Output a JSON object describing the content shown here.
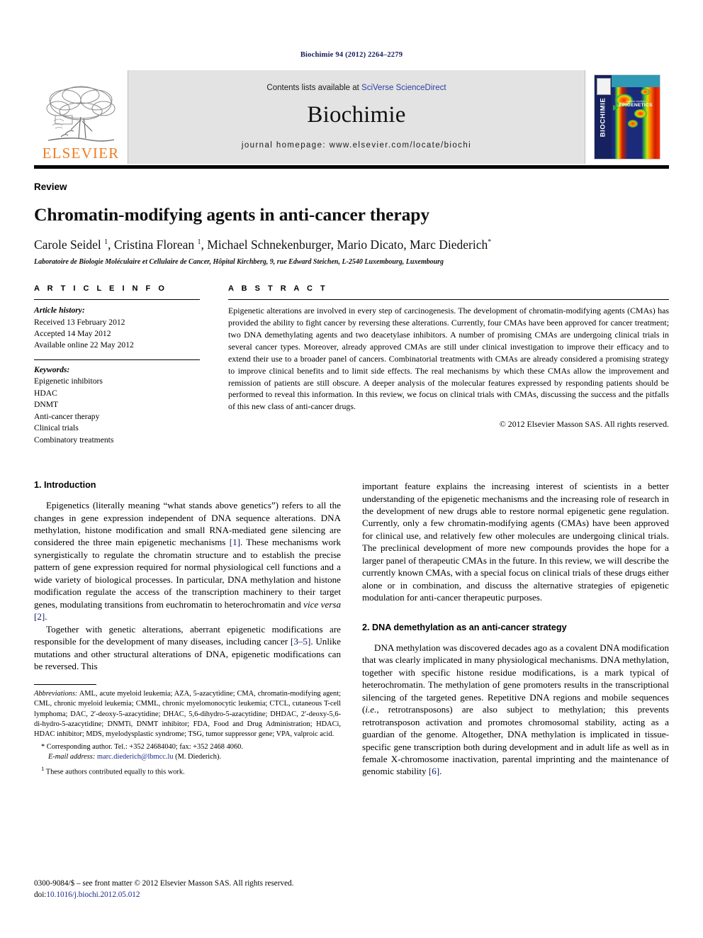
{
  "running_head": "Biochimie 94 (2012) 2264–2279",
  "masthead": {
    "publisher_logo_text": "ELSEVIER",
    "contents_prefix": "Contents lists available at ",
    "contents_link": "SciVerse ScienceDirect",
    "journal_name": "Biochimie",
    "homepage_line": "journal homepage: www.elsevier.com/locate/biochi",
    "cover": {
      "spine_title": "BIOCHIMIE",
      "caption_small": "Special section",
      "caption_big": "EPIGENETICS"
    }
  },
  "article": {
    "doctype": "Review",
    "title": "Chromatin-modifying agents in anti-cancer therapy",
    "authors_html": "Carole Seidel <sup>1</sup>, Cristina Florean <sup>1</sup>, Michael Schnekenburger, Mario Dicato, Marc Diederich<sup class=\"star\">*</sup>",
    "affiliation": "Laboratoire de Biologie Moléculaire et Cellulaire de Cancer, Hôpital Kirchberg, 9, rue Edward Steichen, L-2540 Luxembourg, Luxembourg"
  },
  "article_info": {
    "heading": "A R T I C L E  I N F O",
    "history_label": "Article history:",
    "history": [
      "Received 13 February 2012",
      "Accepted 14 May 2012",
      "Available online 22 May 2012"
    ],
    "keywords_label": "Keywords:",
    "keywords": [
      "Epigenetic inhibitors",
      "HDAC",
      "DNMT",
      "Anti-cancer therapy",
      "Clinical trials",
      "Combinatory treatments"
    ]
  },
  "abstract": {
    "heading": "A B S T R A C T",
    "text": "Epigenetic alterations are involved in every step of carcinogenesis. The development of chromatin-modifying agents (CMAs) has provided the ability to fight cancer by reversing these alterations. Currently, four CMAs have been approved for cancer treatment; two DNA demethylating agents and two deacetylase inhibitors. A number of promising CMAs are undergoing clinical trials in several cancer types. Moreover, already approved CMAs are still under clinical investigation to improve their efficacy and to extend their use to a broader panel of cancers. Combinatorial treatments with CMAs are already considered a promising strategy to improve clinical benefits and to limit side effects. The real mechanisms by which these CMAs allow the improvement and remission of patients are still obscure. A deeper analysis of the molecular features expressed by responding patients should be performed to reveal this information. In this review, we focus on clinical trials with CMAs, discussing the success and the pitfalls of this new class of anti-cancer drugs.",
    "copyright": "© 2012 Elsevier Masson SAS. All rights reserved."
  },
  "sections": {
    "intro_heading": "1.  Introduction",
    "intro_p1_a": "Epigenetics (literally meaning “what stands above genetics”) refers to all the changes in gene expression independent of DNA sequence alterations. DNA methylation, histone modification and small RNA-mediated gene silencing are considered the three main epigenetic mechanisms ",
    "intro_p1_ref1": "[1]",
    "intro_p1_b": ". These mechanisms work synergistically to regulate the chromatin structure and to establish the precise pattern of gene expression required for normal physiological cell functions and a wide variety of biological processes. In particular, DNA methylation and histone modification regulate the access of the transcription machinery to their target genes, modulating transitions from euchromatin to heterochromatin and ",
    "intro_p1_italic": "vice versa",
    "intro_p1_ref2": " [2]",
    "intro_p1_c": ".",
    "intro_p2_a": "Together with genetic alterations, aberrant epigenetic modifications are responsible for the development of many diseases, including cancer ",
    "intro_p2_ref": "[3–5]",
    "intro_p2_b": ". Unlike mutations and other structural alterations of DNA, epigenetic modifications can be reversed. This ",
    "intro_p2_cont": "important feature explains the increasing interest of scientists in a better understanding of the epigenetic mechanisms and the increasing role of research in the development of new drugs able to restore normal epigenetic gene regulation. Currently, only a few chromatin-modifying agents (CMAs) have been approved for clinical use, and relatively few other molecules are undergoing clinical trials. The preclinical development of more new compounds provides the hope for a larger panel of therapeutic CMAs in the future. In this review, we will describe the currently known CMAs, with a special focus on clinical trials of these drugs either alone or in combination, and discuss the alternative strategies of epigenetic modulation for anti-cancer therapeutic purposes.",
    "demeth_heading": "2.  DNA demethylation as an anti-cancer strategy",
    "demeth_p1_a": "DNA methylation was discovered decades ago as a covalent DNA modification that was clearly implicated in many physiological mechanisms. DNA methylation, together with specific histone residue modifications, is a mark typical of heterochromatin. The methylation of gene promoters results in the transcriptional silencing of the targeted genes. Repetitive DNA regions and mobile sequences (",
    "demeth_p1_italic": "i.e.",
    "demeth_p1_b": ", retrotransposons) are also subject to methylation; this prevents retrotransposon activation and promotes chromosomal stability, acting as a guardian of the genome. Altogether, DNA methylation is implicated in tissue-specific gene transcription both during development and in adult life as well as in female X-chromosome inactivation, parental imprinting and the maintenance of genomic stability ",
    "demeth_p1_ref": "[6]",
    "demeth_p1_c": "."
  },
  "footnotes": {
    "abbrev_label": "Abbreviations:",
    "abbrev_text": " AML, acute myeloid leukemia; AZA, 5-azacytidine; CMA, chromatin-modifying agent; CML, chronic myeloid leukemia; CMML, chronic myelomonocytic leukemia; CTCL, cutaneous T-cell lymphoma; DAC, 2′-deoxy-5-azacytidine; DHAC, 5,6-dihydro-5-azacytidine; DHDAC, 2′-deoxy-5,6-di-hydro-5-azacytidine; DNMTi, DNMT inhibitor; FDA, Food and Drug Administration; HDACi, HDAC inhibitor; MDS, myelodysplastic syndrome; TSG, tumor suppressor gene; VPA, valproic acid.",
    "corresponding": "* Corresponding author. Tel.: +352 24684040; fax: +352 2468 4060.",
    "email_label": "E-mail address:",
    "email": "marc.diederich@lbmcc.lu",
    "email_suffix": " (M. Diederich).",
    "equal_contrib_marker": "1",
    "equal_contrib": " These authors contributed equally to this work."
  },
  "footer": {
    "line1": "0300-9084/$ – see front matter © 2012 Elsevier Masson SAS. All rights reserved.",
    "doi_label": "doi:",
    "doi": "10.1016/j.biochi.2012.05.012"
  }
}
